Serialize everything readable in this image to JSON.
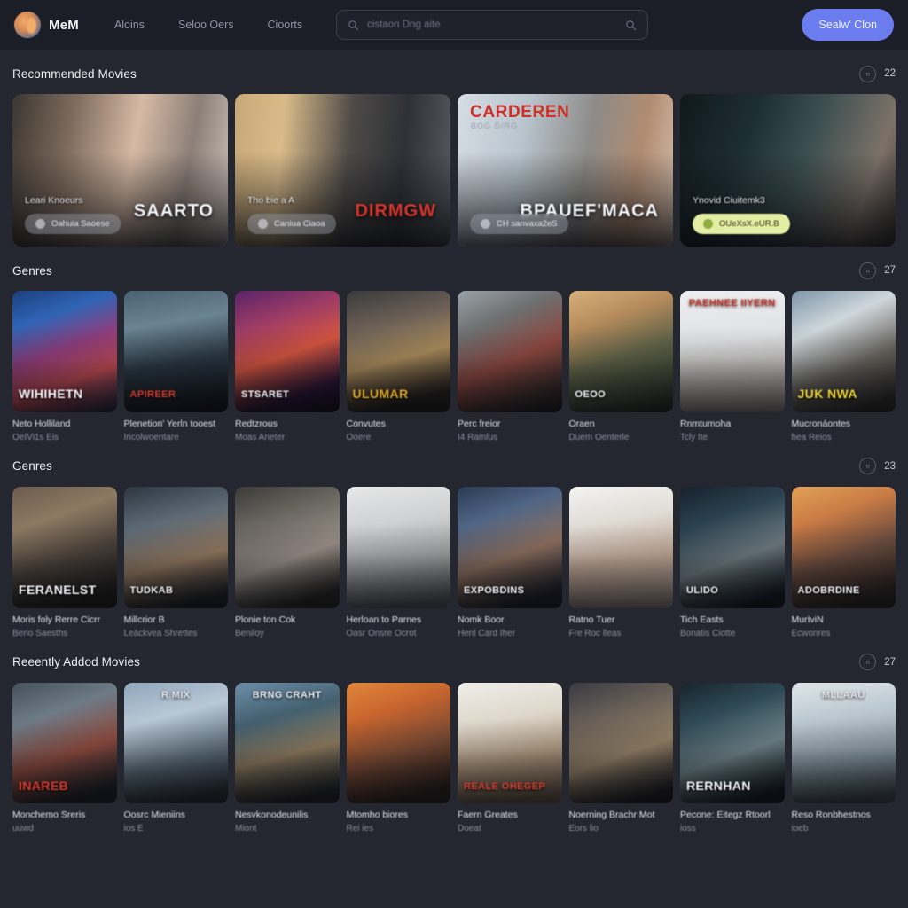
{
  "header": {
    "brand": "MeM",
    "logo_icon": "app-logo-icon",
    "nav": [
      {
        "label": "Aloins"
      },
      {
        "label": "Seloo Oers"
      },
      {
        "label": "Cioorts"
      }
    ],
    "search": {
      "placeholder": "cistaon Dng aite",
      "value": "",
      "left_icon": "search-icon",
      "right_icon": "search-icon"
    },
    "cta_label": "Sealw' Clon",
    "cta_color": "#6b7cee"
  },
  "sections": [
    {
      "title": "Recommended Movies",
      "circle_glyph": "○",
      "count": "22",
      "type": "hero",
      "cards": [
        {
          "title": "Leari Knoeurs",
          "badge": "Oahuia Saoese",
          "badge_style": "glass",
          "logo": "SAARTO",
          "logo_style": "plain",
          "art": "linear-gradient(100deg,#3b3631 0%,#7d6a5c 26%,#d6b9a4 54%,#8c7f78 78%,#cfc3bb 100%)"
        },
        {
          "title": "Tho bie a A",
          "badge": "Caniua  Ciaoa",
          "badge_style": "glass",
          "logo": "DIRMGW",
          "logo_style": "red",
          "art": "linear-gradient(95deg,#c8a877 0%,#d9bb8a 22%,#4e4a47 52%,#2e3136 76%,#565b60 100%)"
        },
        {
          "top_title": "CARDEREN",
          "top_sub": "BOG DIRO",
          "title": "",
          "badge": "CH sanvaxa2eS",
          "badge_style": "glass",
          "logo": "BPAUEF'MACA",
          "logo_style": "plain",
          "art": "linear-gradient(100deg,#d6dde3 0%,#b9c4cd 30%,#8d8b88 58%,#b08c72 80%,#d7c0ae 100%)"
        },
        {
          "title": "Ynovid Ciuitemk3",
          "badge": "OUeXsX.eUR.B",
          "badge_style": "lime",
          "logo": "",
          "logo_style": "plain",
          "art": "linear-gradient(110deg,#10181c 0%,#1d2e33 30%,#3c4f51 55%,#7d7268 82%,#3a3630 100%)"
        }
      ]
    },
    {
      "title": "Genres",
      "circle_glyph": "○",
      "count": "27",
      "type": "grid",
      "cards": [
        {
          "title": "Neto Holliland",
          "sub": "OeIVi1s Eis",
          "word": "WIHIHETN",
          "word_style": "",
          "art": "linear-gradient(160deg,#1c3f7e 0%,#2f64b4 24%,#8e3d7c 48%,#c04a52 70%,#16233f 100%)"
        },
        {
          "title": "Plenetion' Yerln tooest",
          "sub": "Incolwoentare",
          "word": "APIREER",
          "word_style": "red small",
          "art": "linear-gradient(170deg,#4a6170 0%,#6b8494 28%,#2a3742 58%,#0d1116 100%)"
        },
        {
          "title": "Redtzrous",
          "sub": "Moas Aneter",
          "word": "STSARET",
          "word_style": "small",
          "art": "linear-gradient(160deg,#5a2368 0%,#9b3b66 26%,#d3553f 52%,#2a1334 80%,#130a1c 100%)"
        },
        {
          "title": "Convutes",
          "sub": "Ooere",
          "word": "ULUMAR",
          "word_style": "gold",
          "art": "linear-gradient(165deg,#3a3a3c 0%,#6e6257 30%,#ab8c5c 55%,#241f1c 85%)"
        },
        {
          "title": "Perc freior",
          "sub": "I4 Ramlus",
          "word": "",
          "word_style": "",
          "art": "linear-gradient(155deg,#9aa2a8 0%,#6d6f70 28%,#8d4740 56%,#3b2b2a 82%,#181416 100%)"
        },
        {
          "title": "Oraen",
          "sub": "Duem Oenterle",
          "word": "OEOO",
          "word_style": "small",
          "art": "linear-gradient(160deg,#d8b07a 0%,#b58b5c 26%,#5e6247 54%,#3e4434 78%,#22241c 100%)"
        },
        {
          "title": "Rnmtumoha",
          "sub": "Tcly Ite",
          "word": "",
          "word_style": "",
          "top": "PAEHNEE IIYERN",
          "top_style": "red",
          "art": "linear-gradient(175deg,#eceef0 0%,#dfe1e4 40%,#b9b3ae 70%,#8f8680 100%)"
        },
        {
          "title": "Mucronáontes",
          "sub": "hea Reios",
          "word": "JUK NWA",
          "word_style": "yellow",
          "art": "linear-gradient(155deg,#7e95a8 0%,#cfd7dc 30%,#66625c 62%,#2c2a28 90%)"
        }
      ]
    },
    {
      "title": "Genres",
      "circle_glyph": "○",
      "count": "23",
      "type": "grid",
      "cards": [
        {
          "title": "Moris foly Rerre Cicrr",
          "sub": "Berio Saesths",
          "word": "FERANELST",
          "word_style": "",
          "art": "linear-gradient(160deg,#6b5b4d 0%,#8e7a63 28%,#4a413a 58%,#201d1b 88%)"
        },
        {
          "title": "Millcrior B",
          "sub": "Leáckvea Shrettes",
          "word": "TUDKAB",
          "word_style": "small",
          "art": "linear-gradient(165deg,#2c3640 0%,#5d6a76 30%,#93785f 60%,#1d2026 90%)"
        },
        {
          "title": "Plonie ton Cok",
          "sub": "Beniloy",
          "word": "",
          "word_style": "",
          "art": "linear-gradient(160deg,#3b3a38 0%,#6d6a63 30%,#9a9088 58%,#272522 88%)"
        },
        {
          "title": "Herloan to Parnes",
          "sub": "Oasr Onsre Ocrot",
          "word": "",
          "word_style": "",
          "art": "linear-gradient(170deg,#e6e7e9 0%,#cfd0d2 32%,#9a9b9d 64%,#5c5d60 92%)"
        },
        {
          "title": "Nomk Boor",
          "sub": "Henl Card Iher",
          "word": "EXPOBDINS",
          "word_style": "small",
          "art": "linear-gradient(160deg,#2a3a52 0%,#4f6585 26%,#8d6f5e 56%,#1b1f28 88%)"
        },
        {
          "title": "Ratno Tuer",
          "sub": "Fre Roc lleas",
          "word": "",
          "word_style": "",
          "art": "linear-gradient(170deg,#f3f3f2 0%,#e0dcd6 30%,#c2a896 60%,#9e8f86 92%)"
        },
        {
          "title": "Tich Easts",
          "sub": "Bonatis Ciotte",
          "word": "ULIDO",
          "word_style": "small",
          "art": "linear-gradient(160deg,#16212b 0%,#2b4250 28%,#6d7a80 58%,#12181d 90%)"
        },
        {
          "title": "MurIviN",
          "sub": "Ecwonres",
          "word": "ADOBRDINE",
          "word_style": "small",
          "art": "linear-gradient(160deg,#e3a254 0%,#c97b45 26%,#6a4b3e 56%,#2a2320 88%)"
        }
      ]
    },
    {
      "title": "Reeently Addod Movies",
      "circle_glyph": "○",
      "count": "27",
      "type": "grid",
      "cards": [
        {
          "title": "Monchemo Sreris",
          "sub": "uuwd",
          "word": "INAREB",
          "word_style": "red",
          "art": "linear-gradient(160deg,#44505c 0%,#6d7b87 28%,#8c4a3e 58%,#1b2026 88%)"
        },
        {
          "title": "Oosrc Mieniins",
          "sub": "ios  E",
          "word": "",
          "word_style": "",
          "top": "R MIX",
          "top_style": "",
          "art": "linear-gradient(165deg,#8fa6bb 0%,#b9c8d6 30%,#5b6b78 62%,#252c33 92%)"
        },
        {
          "title": "Nesvkonodeunilis",
          "sub": "Miont",
          "word": "",
          "word_style": "",
          "top": "BRNG CRAHT",
          "top_style": "",
          "art": "linear-gradient(165deg,#6d8ea8 0%,#44606f 30%,#8c7a5e 58%,#1e2227 90%)"
        },
        {
          "title": "Mtomho biores",
          "sub": "Rei ies",
          "word": "",
          "word_style": "",
          "art": "linear-gradient(160deg,#e0873a 0%,#c9652f 26%,#7a4a33 56%,#2a1f1b 88%)"
        },
        {
          "title": "Faern Greates",
          "sub": "Doeat",
          "word": "REALE OHEGEP",
          "word_style": "red small",
          "art": "linear-gradient(170deg,#f0eee9 0%,#ded7cb 32%,#a78f76 64%,#6d5a49 92%)"
        },
        {
          "title": "Noerning Brachr Mot",
          "sub": "Eors lio",
          "word": "",
          "word_style": "",
          "art": "linear-gradient(160deg,#3a3a42 0%,#6a6158 30%,#938067 58%,#1d1c20 90%)"
        },
        {
          "title": "Pecone: Eitegz Rtoorl",
          "sub": "ioss",
          "word": "RERNHAN",
          "word_style": "",
          "art": "linear-gradient(160deg,#17242c 0%,#2f4a56 28%,#6e8288 58%,#121a1f 90%)"
        },
        {
          "title": "Reso Ronbhestnos",
          "sub": "ioeb",
          "word": "",
          "word_style": "",
          "top": "MLLAAU",
          "top_style": "",
          "art": "linear-gradient(170deg,#dfe6ea 0%,#b9c6ce 32%,#7d8c95 64%,#424d56 92%)"
        }
      ]
    }
  ]
}
